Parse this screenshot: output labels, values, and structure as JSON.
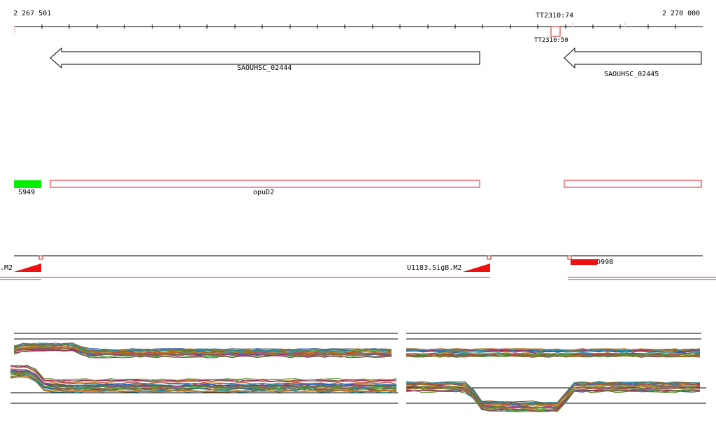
{
  "ruler": {
    "start_label": "2 267 501",
    "end_label": "2 270 000",
    "marker_label": "TT2310:74",
    "marker_sublabel": "TT2310:50"
  },
  "genes": [
    {
      "name": "SAOUHSC_02444",
      "strand": "-"
    },
    {
      "name": "SAOUHSC_02445",
      "strand": "-"
    }
  ],
  "features": [
    {
      "name": "S949",
      "color": "#00ee00"
    },
    {
      "name": "opuD2",
      "color": "#ee2222"
    },
    {
      "name": "",
      "color": "#ee2222"
    }
  ],
  "promoters": [
    {
      "name": ".M2"
    },
    {
      "name": "U1183.SigB.M2"
    },
    {
      "name": "D998"
    }
  ],
  "colors": {
    "gene_outline": "#000000",
    "feature_red": "#ee2222",
    "feature_green": "#00ee00",
    "tss_red": "#ee1111"
  }
}
